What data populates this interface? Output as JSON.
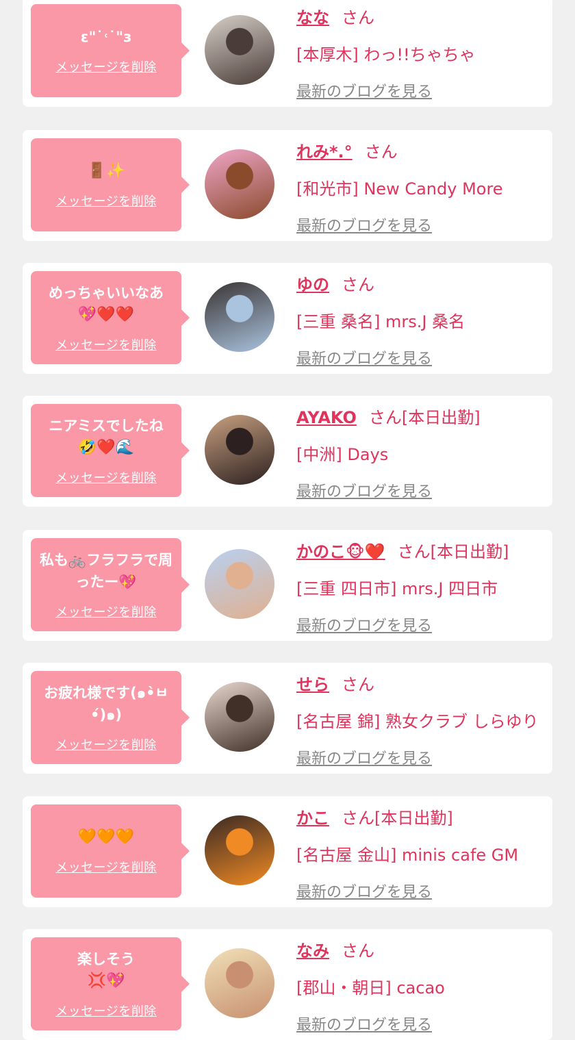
{
  "delete_label": "メッセージを削除",
  "blog_label": "最新のブログを見る",
  "colors": {
    "background": "#f0f0f0",
    "card": "#ffffff",
    "bubble": "#fb98a7",
    "accent": "#e0345d",
    "muted": "#888888"
  },
  "items": [
    {
      "message": "ε\"˙˓˙\"з",
      "emoji": "",
      "name": "なな",
      "suffix": "さん",
      "shop": "[本厚木] わっ!!ちゃちゃ",
      "avatar_colors": [
        "#d7cfc8",
        "#4a3c38"
      ]
    },
    {
      "message": "",
      "emoji": "🚪✨",
      "name": "れみ*.°",
      "suffix": "さん",
      "shop": "[和光市] New Candy More",
      "avatar_colors": [
        "#f0a6c8",
        "#8a4a2c"
      ]
    },
    {
      "message": "めっちゃいいなあ",
      "emoji": "💖❤️❤️",
      "name": "ゆの",
      "suffix": "さん",
      "shop": "[三重 桑名] mrs.J 桑名",
      "avatar_colors": [
        "#3a3332",
        "#aac4e0"
      ]
    },
    {
      "message": "ニアミスでしたね",
      "emoji": "🤣❤️🌊",
      "name": "AYAKO",
      "suffix": "さん[本日出勤]",
      "shop": "[中洲] Days",
      "avatar_colors": [
        "#c8a080",
        "#2c2020"
      ]
    },
    {
      "message": "私も🚲フラフラで周ったー💖",
      "emoji": "",
      "name": "かのこ🐵❤️",
      "suffix": "さん[本日出勤]",
      "shop": "[三重 四日市] mrs.J 四日市",
      "avatar_colors": [
        "#b8d0f0",
        "#e0b090"
      ]
    },
    {
      "message": "お疲れ様です(๑•̀ㅂ•́)๑)",
      "emoji": "",
      "name": "せら",
      "suffix": "さん",
      "shop": "[名古屋 錦] 熟女クラブ しらゆり",
      "avatar_colors": [
        "#e8d8d0",
        "#403028"
      ]
    },
    {
      "message": "",
      "emoji": "🧡🧡🧡",
      "name": "かこ",
      "suffix": "さん[本日出勤]",
      "shop": "[名古屋 金山] minis cafe GM",
      "avatar_colors": [
        "#3a2a24",
        "#f08a24"
      ]
    },
    {
      "message": "楽しそう",
      "emoji": "💢💖",
      "name": "なみ",
      "suffix": "さん",
      "shop": "[郡山・朝日] cacao",
      "avatar_colors": [
        "#f0e0b8",
        "#c89070"
      ]
    }
  ]
}
